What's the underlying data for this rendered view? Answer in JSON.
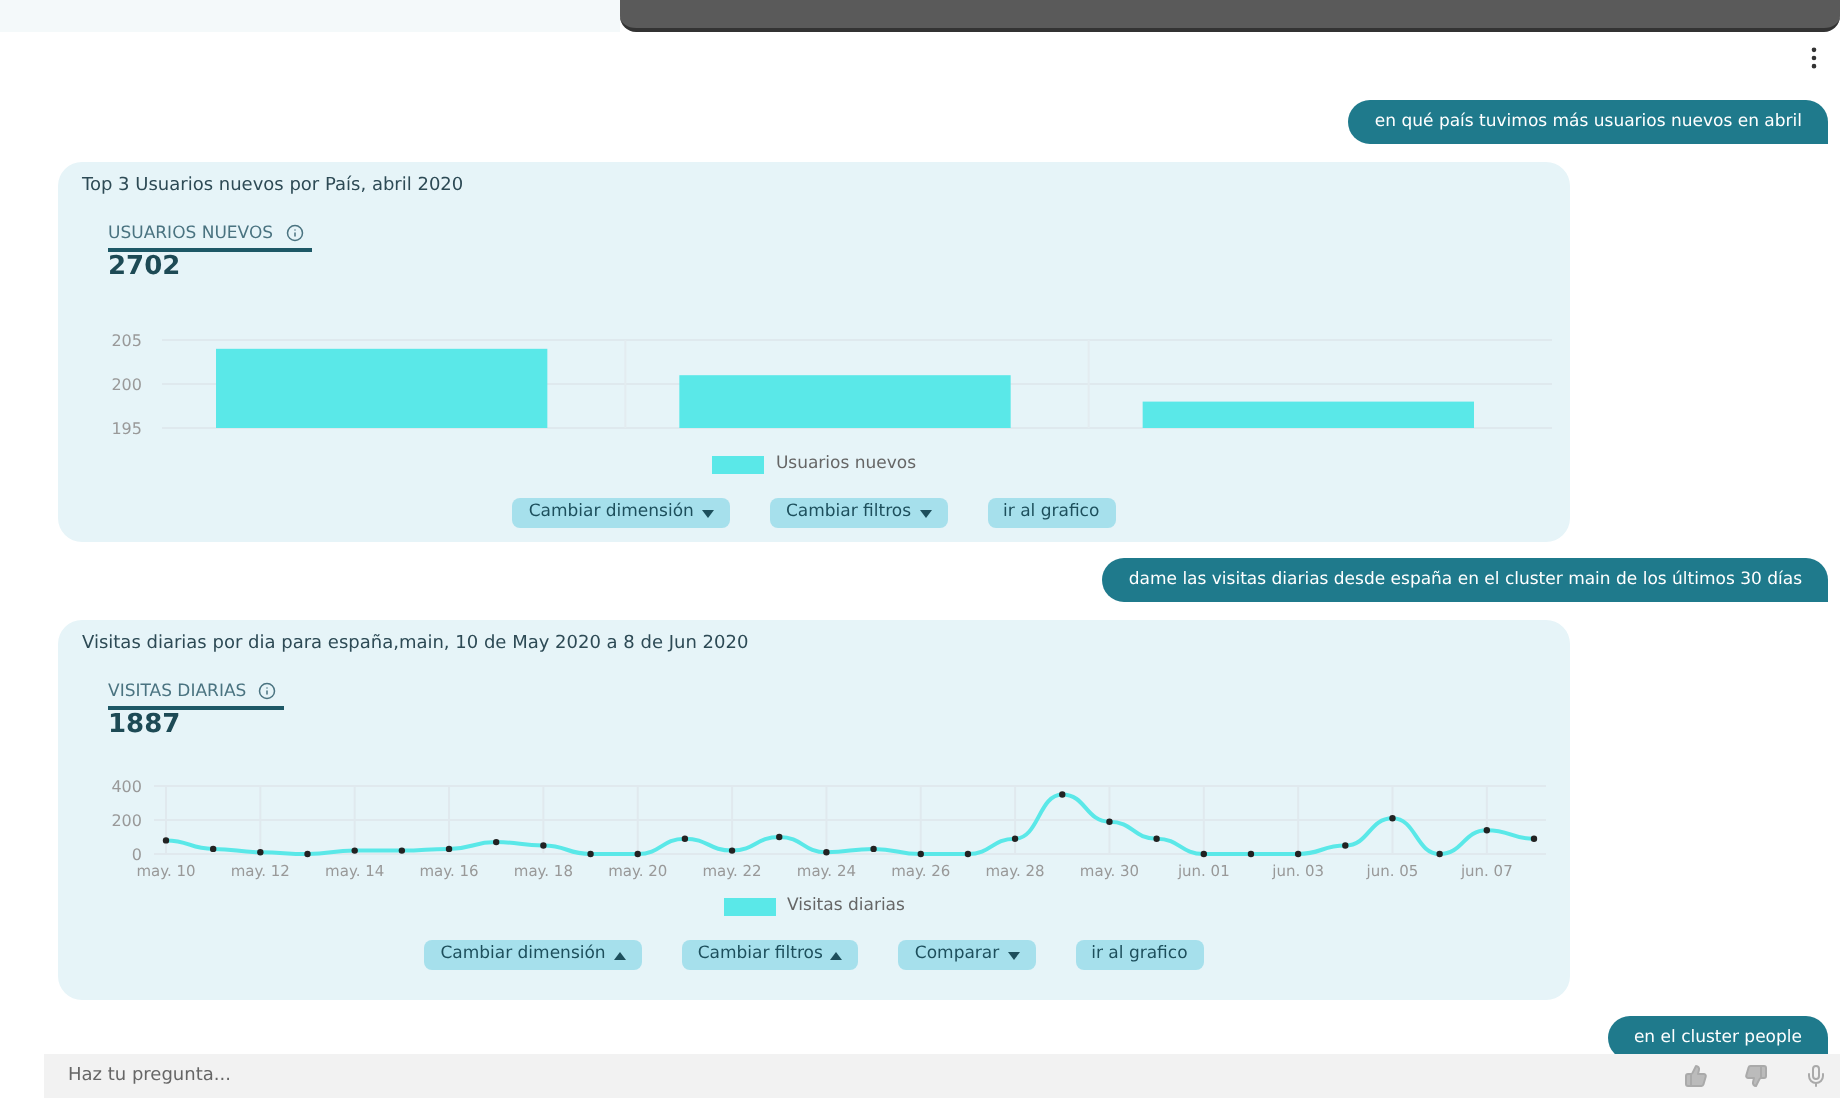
{
  "messages": [
    {
      "kind": "user",
      "text": "en qué país tuvimos más usuarios nuevos en abril"
    },
    {
      "kind": "card",
      "title": "Top 3 Usuarios nuevos por País, abril 2020",
      "metric": {
        "label": "USUARIOS NUEVOS",
        "value": "2702"
      },
      "chart_data": {
        "type": "bar",
        "series": [
          {
            "name": "Usuarios nuevos",
            "color": "#5ae8e8",
            "values": [
              204,
              201,
              198
            ]
          }
        ],
        "ylim": [
          195,
          205
        ],
        "yticks": [
          195,
          200,
          205
        ],
        "grid": true
      },
      "buttons": [
        {
          "label": "Cambiar dimensión",
          "kind": "dropdown"
        },
        {
          "label": "Cambiar filtros",
          "kind": "dropdown"
        },
        {
          "label": "ir al grafico",
          "kind": "plain"
        }
      ]
    },
    {
      "kind": "user",
      "text": "dame las visitas diarias desde españa en el cluster main de los últimos 30 días"
    },
    {
      "kind": "card",
      "title": "Visitas diarias por dia para españa,main, 10 de May 2020 a 8 de Jun 2020",
      "metric": {
        "label": "VISITAS DIARIAS",
        "value": "1887"
      },
      "chart_data": {
        "type": "line",
        "categories": [
          "may. 10",
          null,
          "may. 12",
          null,
          "may. 14",
          null,
          "may. 16",
          null,
          "may. 18",
          null,
          "may. 20",
          null,
          "may. 22",
          null,
          "may. 24",
          null,
          "may. 26",
          null,
          "may. 28",
          null,
          "may. 30",
          null,
          "jun. 01",
          null,
          "jun. 03",
          null,
          "jun. 05",
          null,
          "jun. 07",
          null
        ],
        "series": [
          {
            "name": "Visitas diarias",
            "color": "#5ae8e8",
            "marker": true,
            "values": [
              80,
              30,
              10,
              0,
              20,
              20,
              30,
              70,
              50,
              0,
              0,
              90,
              20,
              100,
              10,
              30,
              0,
              0,
              90,
              350,
              190,
              90,
              0,
              0,
              0,
              50,
              210,
              0,
              140,
              90
            ]
          }
        ],
        "ylim": [
          0,
          400
        ],
        "yticks": [
          0,
          200,
          400
        ],
        "grid": true
      },
      "buttons": [
        {
          "label": "Cambiar dimensión",
          "kind": "dropup"
        },
        {
          "label": "Cambiar filtros",
          "kind": "dropup"
        },
        {
          "label": "Comparar",
          "kind": "dropdown"
        },
        {
          "label": "ir al grafico",
          "kind": "plain"
        }
      ]
    },
    {
      "kind": "user",
      "text": "en el cluster people"
    }
  ],
  "input": {
    "placeholder": "Haz tu pregunta..."
  }
}
